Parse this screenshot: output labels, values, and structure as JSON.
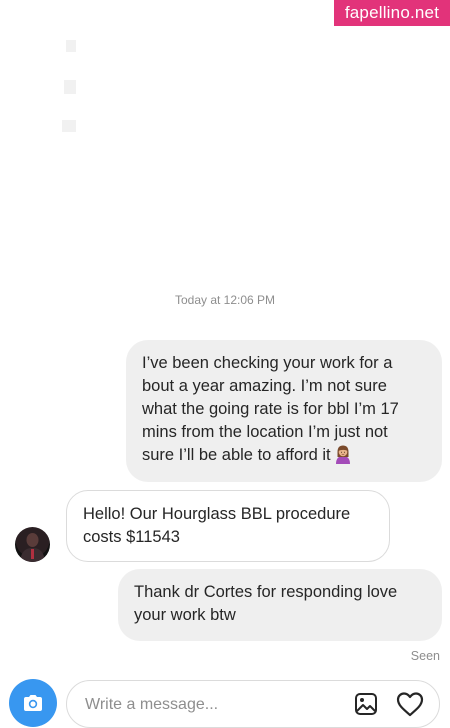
{
  "watermark": "fapellino.net",
  "thread": {
    "timestamp": "Today at 12:06 PM",
    "messages": [
      {
        "direction": "outgoing",
        "lines": [
          "I’ve been checking your work for a",
          "bout a year amazing. I’m not sure",
          "what the going rate is for bbl I’m 17",
          "mins from the location I’m just not",
          "sure I’ll be able to afford it"
        ],
        "emoji": "woman-shrugging-emoji"
      },
      {
        "direction": "incoming",
        "lines": [
          "Hello! Our Hourglass BBL procedure",
          "costs $11543"
        ]
      },
      {
        "direction": "outgoing",
        "lines": [
          "Thank dr Cortes for responding love",
          "your work btw"
        ]
      }
    ],
    "seen_label": "Seen"
  },
  "composer": {
    "placeholder": "Write a message...",
    "value": "",
    "icons": [
      "camera-icon",
      "gallery-icon",
      "heart-icon"
    ]
  },
  "colors": {
    "outgoing_bubble": "#efefef",
    "incoming_border": "#dbdbdb",
    "camera_button": "#3897f0",
    "watermark_bg": "#e2337a",
    "meta_text": "#8e8e8e"
  }
}
